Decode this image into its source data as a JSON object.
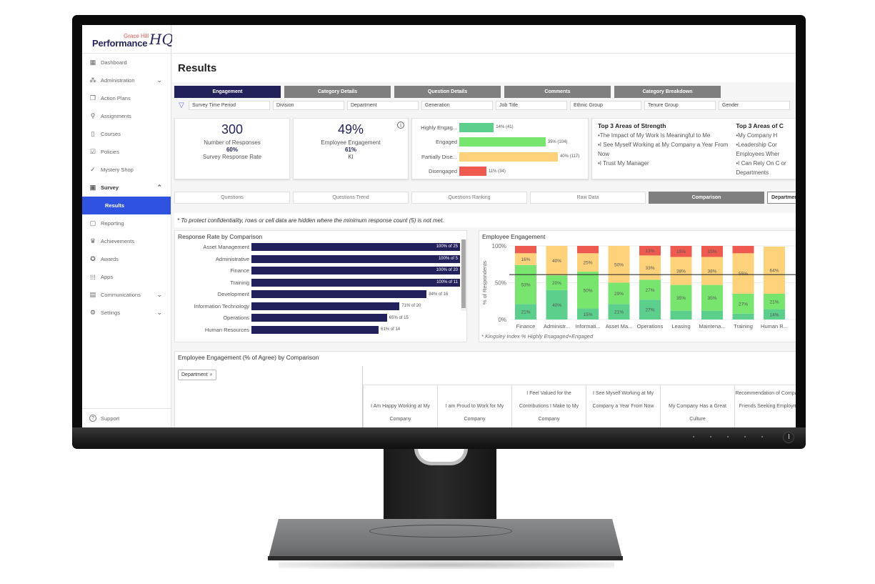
{
  "app": {
    "logo_top": "Grace Hill",
    "logo_main": "Performance",
    "logo_hq": "HQ"
  },
  "sidebar": {
    "items": [
      {
        "label": "Dashboard",
        "icon": "dashboard-icon",
        "glyph": "▦"
      },
      {
        "label": "Administration",
        "icon": "people-icon",
        "glyph": "⁂",
        "chevron": "⌄"
      },
      {
        "label": "Action Plans",
        "icon": "action-plans-icon",
        "glyph": "❐"
      },
      {
        "label": "Assignments",
        "icon": "assignments-icon",
        "glyph": "⚲"
      },
      {
        "label": "Courses",
        "icon": "courses-icon",
        "glyph": "▯"
      },
      {
        "label": "Policies",
        "icon": "policies-icon",
        "glyph": "☑"
      },
      {
        "label": "Mystery Shop",
        "icon": "check-circle-icon",
        "glyph": "✓"
      },
      {
        "label": "Survey",
        "icon": "survey-icon",
        "glyph": "▣",
        "chevron": "⌃"
      }
    ],
    "active_sub": "Results",
    "items_after": [
      {
        "label": "Reporting",
        "icon": "reporting-icon",
        "glyph": "▢"
      },
      {
        "label": "Achievements",
        "icon": "trophy-icon",
        "glyph": "♛"
      },
      {
        "label": "Awards",
        "icon": "award-icon",
        "glyph": "✪"
      },
      {
        "label": "Apps",
        "icon": "apps-grid-icon",
        "glyph": "⁞⁞⁞"
      },
      {
        "label": "Communications",
        "icon": "communications-icon",
        "glyph": "▤",
        "chevron": "⌄"
      },
      {
        "label": "Settings",
        "icon": "gear-icon",
        "glyph": "⚙",
        "chevron": "⌄"
      }
    ],
    "support": "Support"
  },
  "page": {
    "title": "Results"
  },
  "tabs": [
    {
      "label": "Engagement",
      "active": true
    },
    {
      "label": "Category Details"
    },
    {
      "label": "Question Details"
    },
    {
      "label": "Comments"
    },
    {
      "label": "Category Breakdown"
    }
  ],
  "filters": [
    "Survey Time Period",
    "Division",
    "Department",
    "Generation",
    "Job Title",
    "Ethnic Group",
    "Tenure Group",
    "Gender"
  ],
  "kpis": {
    "responses": {
      "value": "300",
      "label": "Number of Responses",
      "pct": "60%",
      "pct_label": "Survey Response Rate"
    },
    "engagement": {
      "value": "49%",
      "label": "Employee Engagement",
      "pct": "61%",
      "pct_label": "KI"
    }
  },
  "engagement_breakdown": [
    {
      "label": "Highly Engag...",
      "pct": 14,
      "count": 41,
      "text": "14% (41)",
      "color": "#5ccf8c"
    },
    {
      "label": "Engaged",
      "pct": 35,
      "count": 104,
      "text": "35% (104)",
      "color": "#78e66e"
    },
    {
      "label": "Partially Dise...",
      "pct": 40,
      "count": 117,
      "text": "40% (117)",
      "color": "#fdd27a"
    },
    {
      "label": "Disengaged",
      "pct": 11,
      "count": 34,
      "text": "11% (34)",
      "color": "#ee5a4f"
    }
  ],
  "strengths": {
    "title": "Top 3 Areas of Strength",
    "items": [
      "•The Impact of My Work Is Meaningful to Me",
      "•I See Myself Working at My Company a Year From Now",
      "•I Trust My Manager"
    ]
  },
  "opportunities": {
    "title": "Top 3 Areas of C",
    "items": [
      "•My Company H",
      "•Leadership Cor Employees Wher",
      "•I Can Rely On C or Departments"
    ]
  },
  "subtabs": [
    {
      "label": "Questions"
    },
    {
      "label": "Questions Trend"
    },
    {
      "label": "Questions Ranking"
    },
    {
      "label": "Raw Data"
    },
    {
      "label": "Comparison",
      "active": true
    }
  ],
  "subtab_dropdown": "Department",
  "notice": "* To protect confidentiality, rows or cell data are hidden where the minimum response count (5) is not met.",
  "chart_data": [
    {
      "type": "bar",
      "orientation": "horizontal",
      "title": "Response Rate by Comparison",
      "categories": [
        "Asset Management",
        "Administrative",
        "Finance",
        "Training",
        "Development",
        "Information Technology",
        "Operations",
        "Human Resources"
      ],
      "values": [
        100,
        100,
        100,
        100,
        84,
        71,
        65,
        61
      ],
      "totals": [
        25,
        5,
        20,
        11,
        16,
        20,
        15,
        14
      ],
      "labels": [
        "100% of 25",
        "100% of 5",
        "100% of 20",
        "100% of 11",
        "84% of 16",
        "71% of 20",
        "65% of 15",
        "61% of 14"
      ],
      "xlim": [
        0,
        100
      ],
      "color": "#22215b"
    },
    {
      "type": "bar",
      "stacked": true,
      "title": "Employee Engagement",
      "ylabel": "% of Respondents",
      "yticks": [
        "0%",
        "50%",
        "100%"
      ],
      "ylim": [
        0,
        100
      ],
      "categories": [
        "Finance",
        "Administr...",
        "Informati...",
        "Asset Ma...",
        "Operations",
        "Leasing",
        "Maintena...",
        "Training",
        "Human R..."
      ],
      "series": [
        {
          "name": "Highly Engaged",
          "color": "#5ccf8c",
          "values": [
            21,
            40,
            15,
            21,
            27,
            12,
            12,
            8,
            14
          ]
        },
        {
          "name": "Engaged",
          "color": "#78e66e",
          "values": [
            53,
            20,
            50,
            29,
            27,
            35,
            35,
            27,
            21
          ]
        },
        {
          "name": "Partially Disengaged",
          "color": "#fdd27a",
          "values": [
            16,
            40,
            25,
            50,
            33,
            38,
            38,
            55,
            64
          ]
        },
        {
          "name": "Disengaged",
          "color": "#ee5a4f",
          "values": [
            10,
            0,
            10,
            0,
            13,
            15,
            15,
            10,
            0
          ]
        }
      ],
      "value_labels": [
        [
          "21%",
          "53%",
          "16%",
          ""
        ],
        [
          "40%",
          "20%",
          "40%",
          ""
        ],
        [
          "15%",
          "50%",
          "25%",
          ""
        ],
        [
          "21%",
          "29%",
          "50%",
          ""
        ],
        [
          "27%",
          "27%",
          "33%",
          "13%"
        ],
        [
          "",
          "35%",
          "38%",
          "15%"
        ],
        [
          "",
          "35%",
          "38%",
          "15%"
        ],
        [
          "",
          "27%",
          "55%",
          ""
        ],
        [
          "14%",
          "21%",
          "64%",
          ""
        ]
      ],
      "reference_line": 61,
      "footnote": "* Kingsley Index % Highly Enagaged+Engaged"
    }
  ],
  "comparison_table": {
    "title": "Employee Engagement (% of Agree) by Comparison",
    "row_header_button": "Department",
    "columns": [
      "I Am Happy Working at My Company",
      "I am Proud to Work for My Company",
      "I Feel Valued for the Contributions I Make to My Company",
      "I See Myself Working at My Company a Year From Now",
      "My Company Has a Great Culture",
      "Recommendation of Company to Friends Seeking Employment"
    ]
  }
}
